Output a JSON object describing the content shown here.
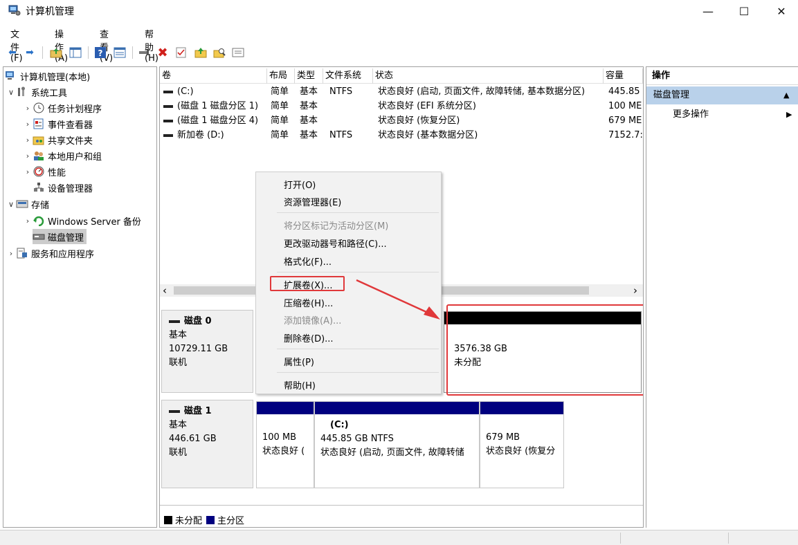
{
  "window": {
    "title": "计算机管理",
    "minimize": "—",
    "maximize": "☐",
    "close": "✕"
  },
  "menu": [
    "文件(F)",
    "操作(A)",
    "查看(V)",
    "帮助(H)"
  ],
  "tree": {
    "root": "计算机管理(本地)",
    "system_tools": "系统工具",
    "task_scheduler": "任务计划程序",
    "event_viewer": "事件查看器",
    "shared_folders": "共享文件夹",
    "local_users": "本地用户和组",
    "performance": "性能",
    "device_manager": "设备管理器",
    "storage": "存储",
    "windows_server_backup": "Windows Server 备份",
    "disk_management": "磁盘管理",
    "services": "服务和应用程序"
  },
  "list": {
    "headers": [
      "卷",
      "布局",
      "类型",
      "文件系统",
      "状态",
      "容量"
    ],
    "rows": [
      [
        "(C:)",
        "简单",
        "基本",
        "NTFS",
        "状态良好 (启动, 页面文件, 故障转储, 基本数据分区)",
        "445.85"
      ],
      [
        "(磁盘 1 磁盘分区 1)",
        "简单",
        "基本",
        "",
        "状态良好 (EFI 系统分区)",
        "100 ME"
      ],
      [
        "(磁盘 1 磁盘分区 4)",
        "简单",
        "基本",
        "",
        "状态良好 (恢复分区)",
        "679 ME"
      ],
      [
        "新加卷 (D:)",
        "简单",
        "基本",
        "NTFS",
        "状态良好 (基本数据分区)",
        "7152.7:"
      ]
    ],
    "scroll_left": "‹",
    "scroll_right": "›"
  },
  "disks": {
    "disk0": {
      "name": "磁盘 0",
      "type": "基本",
      "size": "10729.11 GB",
      "status": "联机",
      "unalloc": {
        "size": "3576.38 GB",
        "label": "未分配"
      }
    },
    "disk1": {
      "name": "磁盘 1",
      "type": "基本",
      "size": "446.61 GB",
      "status": "联机",
      "p1": {
        "size": "100 MB",
        "status": "状态良好 ("
      },
      "p2": {
        "name": "(C:)",
        "size": "445.85 GB NTFS",
        "status": "状态良好 (启动, 页面文件, 故障转储"
      },
      "p3": {
        "size": "679 MB",
        "status": "状态良好 (恢复分"
      }
    }
  },
  "legend": {
    "unallocated": "未分配",
    "primary": "主分区",
    "unallocated_color": "#000000",
    "primary_color": "#00007f"
  },
  "actions": {
    "title": "操作",
    "section": "磁盘管理",
    "more": "更多操作",
    "section_arrow": "▲",
    "more_arrow": "▶"
  },
  "context_menu": {
    "open": "打开(O)",
    "explorer": "资源管理器(E)",
    "mark_active": "将分区标记为活动分区(M)",
    "change_letter": "更改驱动器号和路径(C)...",
    "format": "格式化(F)...",
    "extend": "扩展卷(X)...",
    "shrink": "压缩卷(H)...",
    "add_mirror": "添加镜像(A)...",
    "delete": "删除卷(D)...",
    "properties": "属性(P)",
    "help": "帮助(H)"
  },
  "colors": {
    "annotation_red": "#e0383a",
    "selection_blue": "#b9d1ea"
  }
}
